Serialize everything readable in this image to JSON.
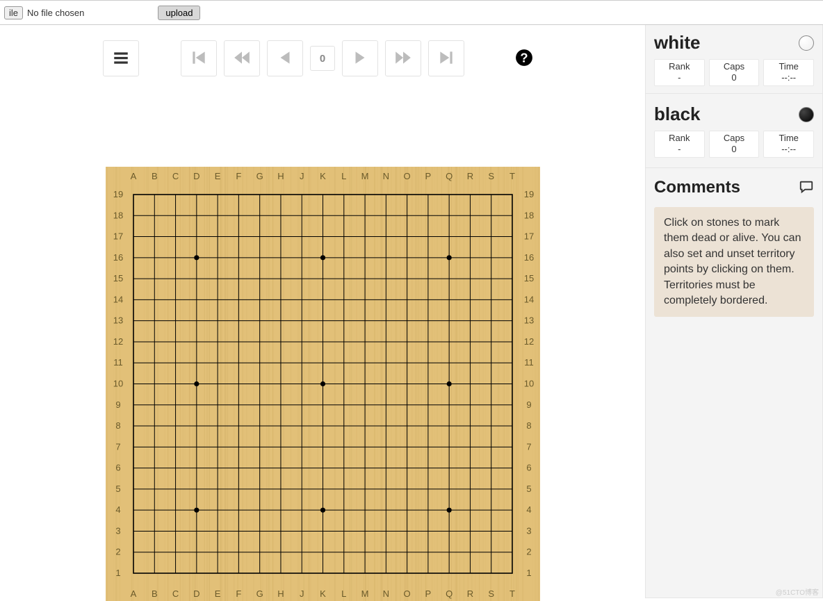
{
  "file": {
    "button_label": "ile",
    "status_text": "No file chosen",
    "upload_label": "upload"
  },
  "toolbar": {
    "move_count": "0"
  },
  "players": {
    "white": {
      "name": "white",
      "rank_label": "Rank",
      "rank_value": "-",
      "caps_label": "Caps",
      "caps_value": "0",
      "time_label": "Time",
      "time_value": "--:--"
    },
    "black": {
      "name": "black",
      "rank_label": "Rank",
      "rank_value": "-",
      "caps_label": "Caps",
      "caps_value": "0",
      "time_label": "Time",
      "time_value": "--:--"
    }
  },
  "comments": {
    "heading": "Comments",
    "body": "Click on stones to mark them dead or alive. You can also set and unset territory points by clicking on them. Territories must be completely bordered."
  },
  "board": {
    "size": 19,
    "columns": [
      "A",
      "B",
      "C",
      "D",
      "E",
      "F",
      "G",
      "H",
      "J",
      "K",
      "L",
      "M",
      "N",
      "O",
      "P",
      "Q",
      "R",
      "S",
      "T"
    ],
    "rows": [
      19,
      18,
      17,
      16,
      15,
      14,
      13,
      12,
      11,
      10,
      9,
      8,
      7,
      6,
      5,
      4,
      3,
      2,
      1
    ],
    "star_points": [
      [
        3,
        3
      ],
      [
        3,
        9
      ],
      [
        3,
        15
      ],
      [
        9,
        3
      ],
      [
        9,
        9
      ],
      [
        9,
        15
      ],
      [
        15,
        3
      ],
      [
        15,
        9
      ],
      [
        15,
        15
      ]
    ]
  },
  "watermark": "@51CTO博客"
}
